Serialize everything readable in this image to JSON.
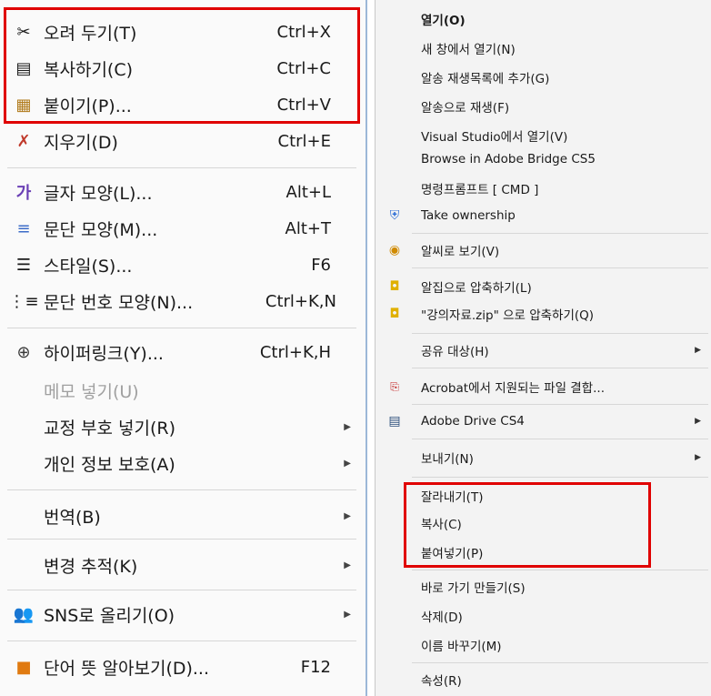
{
  "left_menu": {
    "items": [
      {
        "icon": "scissors-icon",
        "label": "오려 두기(T)",
        "shortcut": "Ctrl+X"
      },
      {
        "icon": "copy-icon",
        "label": "복사하기(C)",
        "shortcut": "Ctrl+C"
      },
      {
        "icon": "paste-icon",
        "label": "붙이기(P)...",
        "shortcut": "Ctrl+V"
      },
      {
        "icon": "erase-icon",
        "label": "지우기(D)",
        "shortcut": "Ctrl+E"
      },
      {
        "icon": "font-icon",
        "label": "글자 모양(L)...",
        "shortcut": "Alt+L"
      },
      {
        "icon": "paragraph-icon",
        "label": "문단 모양(M)...",
        "shortcut": "Alt+T"
      },
      {
        "icon": "style-icon",
        "label": "스타일(S)...",
        "shortcut": "F6"
      },
      {
        "icon": "numbering-icon",
        "label": "문단 번호 모양(N)...",
        "shortcut": "Ctrl+K,N"
      },
      {
        "icon": "hyperlink-icon",
        "label": "하이퍼링크(Y)...",
        "shortcut": "Ctrl+K,H"
      },
      {
        "icon": "",
        "label": "메모 넣기(U)",
        "shortcut": ""
      },
      {
        "icon": "",
        "label": "교정 부호 넣기(R)",
        "shortcut": ""
      },
      {
        "icon": "",
        "label": "개인 정보 보호(A)",
        "shortcut": ""
      },
      {
        "icon": "",
        "label": "번역(B)",
        "shortcut": ""
      },
      {
        "icon": "",
        "label": "변경 추적(K)",
        "shortcut": ""
      },
      {
        "icon": "sns-icon",
        "label": "SNS로 올리기(O)",
        "shortcut": ""
      },
      {
        "icon": "dictionary-icon",
        "label": "단어 뜻 알아보기(D)...",
        "shortcut": "F12"
      }
    ]
  },
  "right_menu": {
    "items": [
      {
        "label": "열기(O)"
      },
      {
        "label": "새 창에서 열기(N)"
      },
      {
        "label": "알송 재생목록에 추가(G)"
      },
      {
        "label": "알송으로 재생(F)"
      },
      {
        "label": "Visual Studio에서 열기(V)"
      },
      {
        "label": "Browse in Adobe Bridge CS5"
      },
      {
        "label": "명령프롬프트 [ CMD ]"
      },
      {
        "label": "Take ownership"
      },
      {
        "label": "알씨로 보기(V)"
      },
      {
        "label": "알집으로 압축하기(L)"
      },
      {
        "label": "\"강의자료.zip\" 으로 압축하기(Q)"
      },
      {
        "label": "공유 대상(H)"
      },
      {
        "label": "Acrobat에서 지원되는 파일 결합..."
      },
      {
        "label": "Adobe Drive CS4"
      },
      {
        "label": "보내기(N)"
      },
      {
        "label": "잘라내기(T)"
      },
      {
        "label": "복사(C)"
      },
      {
        "label": "붙여넣기(P)"
      },
      {
        "label": "바로 가기 만들기(S)"
      },
      {
        "label": "삭제(D)"
      },
      {
        "label": "이름 바꾸기(M)"
      },
      {
        "label": "속성(R)"
      }
    ]
  },
  "colors": {
    "highlight_box": "#e00000",
    "menu_border": "#9cb8d8"
  }
}
